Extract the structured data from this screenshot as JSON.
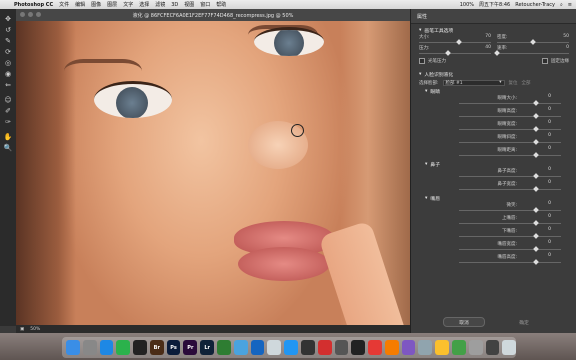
{
  "menubar": {
    "apple": "",
    "app": "Photoshop CC",
    "items": [
      "文件",
      "编辑",
      "图像",
      "图层",
      "文字",
      "选择",
      "滤镜",
      "3D",
      "视图",
      "窗口",
      "帮助"
    ],
    "battery": "100%",
    "clock": "周五下午8:46",
    "user": "Retoucher-Tracy"
  },
  "document": {
    "title": "液化 @ 86FCFECF6A0E1F2EF77F74D468_recompress.jpg @ 50%",
    "zoom": "50%"
  },
  "tools": [
    {
      "name": "move-tool-icon",
      "glyph": "✥"
    },
    {
      "name": "reconstruct-tool-icon",
      "glyph": "↺"
    },
    {
      "name": "smooth-tool-icon",
      "glyph": "✎"
    },
    {
      "name": "twirl-tool-icon",
      "glyph": "⟳"
    },
    {
      "name": "pucker-tool-icon",
      "glyph": "◎"
    },
    {
      "name": "bloat-tool-icon",
      "glyph": "◉"
    },
    {
      "name": "push-left-tool-icon",
      "glyph": "⇐"
    },
    {
      "name": "face-tool-icon",
      "glyph": "☺"
    },
    {
      "name": "freeze-mask-tool-icon",
      "glyph": "✐"
    },
    {
      "name": "thaw-mask-tool-icon",
      "glyph": "✑"
    },
    {
      "name": "hand-tool-icon",
      "glyph": "✋"
    },
    {
      "name": "zoom-tool-icon",
      "glyph": "🔍"
    }
  ],
  "panel": {
    "title": "属性",
    "brush": {
      "title": "画笔工具选项",
      "size_label": "大小:",
      "size_value": "70",
      "density_label": "密度:",
      "density_value": "50",
      "pressure_label": "压力:",
      "pressure_value": "40",
      "rate_label": "速率:",
      "rate_value": "0",
      "size_pos": 0.55,
      "density_pos": 0.5,
      "pressure_pos": 0.4,
      "rate_pos": 0.0,
      "stylus_label": "光笔压力",
      "pin_label": "固定边缘"
    },
    "face": {
      "title": "人脸识别液化",
      "select_label": "选择脸部:",
      "select_value": "脸部 #1",
      "reset_label": "复位",
      "all_label": "全部",
      "eyes_title": "眼睛",
      "eyes_rows": [
        {
          "label": "眼睛大小:",
          "value": "0"
        },
        {
          "label": "眼睛高度:",
          "value": "0"
        },
        {
          "label": "眼睛宽度:",
          "value": "0"
        },
        {
          "label": "眼睛斜度:",
          "value": "0"
        },
        {
          "label": "眼睛距离:",
          "value": "0"
        }
      ],
      "nose_title": "鼻子",
      "nose_rows": [
        {
          "label": "鼻子高度:",
          "value": "0"
        },
        {
          "label": "鼻子宽度:",
          "value": "0"
        }
      ],
      "mouth_title": "嘴唇",
      "mouth_rows": [
        {
          "label": "微笑:",
          "value": "0"
        },
        {
          "label": "上嘴唇:",
          "value": "0"
        },
        {
          "label": "下嘴唇:",
          "value": "0"
        },
        {
          "label": "嘴唇宽度:",
          "value": "0"
        },
        {
          "label": "嘴唇高度:",
          "value": "0"
        }
      ]
    },
    "cancel_label": "取消",
    "ok_label": "确定"
  },
  "dock": [
    {
      "name": "finder-icon",
      "label": "",
      "color": "#3a8ee6"
    },
    {
      "name": "launchpad-icon",
      "label": "",
      "color": "#888"
    },
    {
      "name": "safari-icon",
      "label": "",
      "color": "#1e88e5"
    },
    {
      "name": "wechat-icon",
      "label": "",
      "color": "#2bb24c"
    },
    {
      "name": "qq-icon",
      "label": "",
      "color": "#222"
    },
    {
      "name": "bridge-icon",
      "label": "Br",
      "color": "#4a2c16"
    },
    {
      "name": "photoshop-icon",
      "label": "Ps",
      "color": "#0a1c3a"
    },
    {
      "name": "premiere-icon",
      "label": "Pr",
      "color": "#2a0a3a"
    },
    {
      "name": "lightroom-icon",
      "label": "Lr",
      "color": "#0f2238"
    },
    {
      "name": "camtasia-icon",
      "label": "",
      "color": "#2e7d32"
    },
    {
      "name": "app-blue-icon",
      "label": "",
      "color": "#4aa3df"
    },
    {
      "name": "app-ring-icon",
      "label": "",
      "color": "#1565c0"
    },
    {
      "name": "app-circle-icon",
      "label": "",
      "color": "#cfd8dc"
    },
    {
      "name": "app-info-icon",
      "label": "",
      "color": "#2196f3"
    },
    {
      "name": "davinci-icon",
      "label": "",
      "color": "#333"
    },
    {
      "name": "app-red-icon",
      "label": "",
      "color": "#d32f2f"
    },
    {
      "name": "app-camera-icon",
      "label": "",
      "color": "#555"
    },
    {
      "name": "obs-icon",
      "label": "",
      "color": "#222"
    },
    {
      "name": "app-weibo-icon",
      "label": "",
      "color": "#e53935"
    },
    {
      "name": "app-jigsaw-icon",
      "label": "",
      "color": "#f57c00"
    },
    {
      "name": "app-cards-icon",
      "label": "",
      "color": "#7e57c2"
    },
    {
      "name": "preview-icon",
      "label": "",
      "color": "#90a4ae"
    },
    {
      "name": "app-keynote-icon",
      "label": "",
      "color": "#fbc02d"
    },
    {
      "name": "app-chart-icon",
      "label": "",
      "color": "#43a047"
    },
    {
      "name": "app-gray-icon",
      "label": "",
      "color": "#9e9e9e"
    },
    {
      "name": "app-dark-icon",
      "label": "",
      "color": "#424242"
    },
    {
      "name": "trash-icon",
      "label": "",
      "color": "#cfd8dc"
    }
  ]
}
